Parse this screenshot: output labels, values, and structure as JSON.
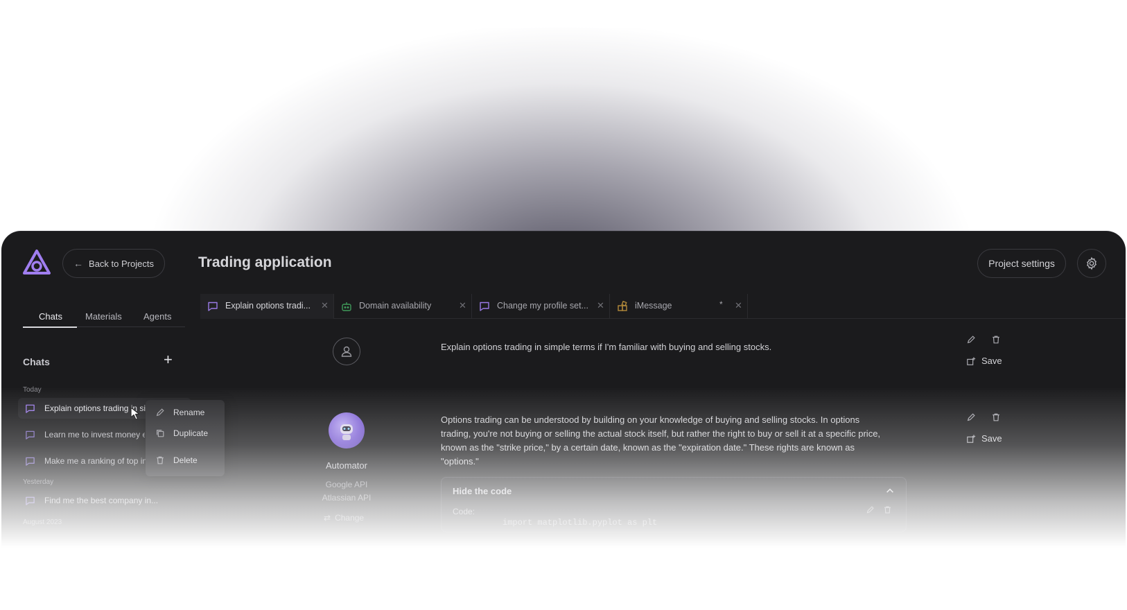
{
  "header": {
    "back_label": "Back to Projects",
    "title": "Trading application",
    "settings_label": "Project settings"
  },
  "sidebar": {
    "tabs": [
      {
        "label": "Chats",
        "active": true
      },
      {
        "label": "Materials",
        "active": false
      },
      {
        "label": "Agents",
        "active": false
      }
    ],
    "section_title": "Chats",
    "groups": [
      {
        "label": "Today"
      },
      {
        "label": "Yesterday"
      },
      {
        "label": "August 2023"
      }
    ],
    "chats": [
      {
        "label": "Explain options trading in simple terms",
        "group": "Today",
        "active": true
      },
      {
        "label": "Learn me to invest money efficiently",
        "group": "Today",
        "active": false
      },
      {
        "label": "Make me a ranking of top investments",
        "group": "Today",
        "active": false
      },
      {
        "label": "Find me the best company in...",
        "group": "Yesterday",
        "active": false
      }
    ]
  },
  "context_menu": {
    "items": [
      {
        "label": "Rename",
        "icon": "pencil-icon"
      },
      {
        "label": "Duplicate",
        "icon": "duplicate-icon"
      },
      {
        "label": "Delete",
        "icon": "trash-icon"
      }
    ]
  },
  "tabs": [
    {
      "label": "Explain options tradi...",
      "icon": "chat-bubble-icon",
      "active": true
    },
    {
      "label": "Domain availability",
      "icon": "robot-icon",
      "active": false
    },
    {
      "label": "Change my profile set...",
      "icon": "chat-bubble-icon",
      "active": false
    },
    {
      "label": "iMessage",
      "icon": "grid-icon",
      "active": false,
      "modified_marker": "*"
    }
  ],
  "messages": [
    {
      "role": "user",
      "text": "Explain options trading in simple terms if I'm familiar with buying and selling stocks.",
      "save_label": "Save"
    },
    {
      "role": "assistant",
      "agent_name": "Automator",
      "apis": [
        "Google API",
        "Atlassian API"
      ],
      "change_label": "Change",
      "text_lines": [
        "Options trading can be understood by building on your knowledge of buying and selling stocks. In options",
        "trading, you're not buying or selling the actual stock itself, but rather the right to buy or sell it at a specific price,",
        "known as the \"strike price,\" by a certain date, known as the \"expiration date.\" These rights are known as",
        "\"options.\""
      ],
      "save_label": "Save",
      "code_block": {
        "title": "Hide the code",
        "label": "Code:",
        "code": "import matplotlib.pyplot as plt"
      }
    }
  ],
  "colors": {
    "accent": "#9b7be8",
    "background": "#1b1b1d",
    "robot_tab_icon": "#3f9a5a",
    "grid_tab_icon": "#b38a3a"
  }
}
